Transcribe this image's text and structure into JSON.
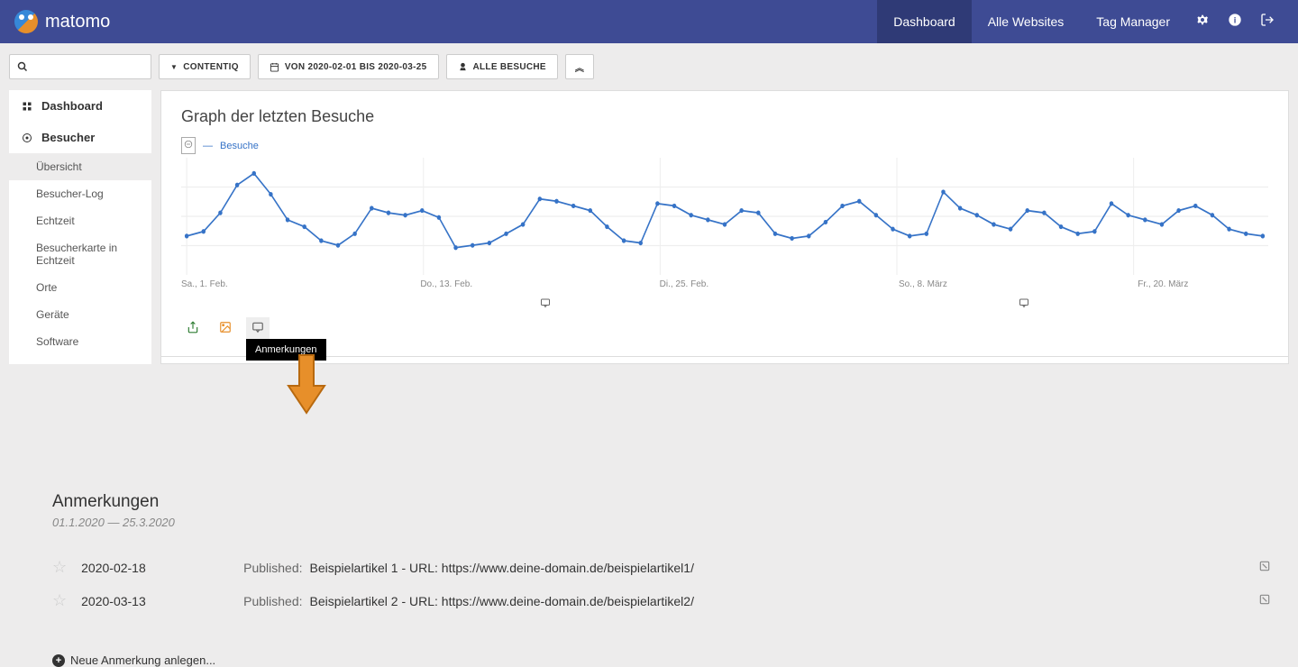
{
  "header": {
    "brand": "matomo",
    "nav": {
      "dashboard": "Dashboard",
      "all_websites": "Alle Websites",
      "tag_manager": "Tag Manager"
    }
  },
  "toolbar": {
    "site_selector": "CONTENTIQ",
    "date_range": "VON 2020-02-01 BIS 2020-03-25",
    "segment": "ALLE BESUCHE"
  },
  "sidebar": {
    "dashboard": "Dashboard",
    "visitors": "Besucher",
    "items": {
      "overview": "Übersicht",
      "visitor_log": "Besucher-Log",
      "realtime": "Echtzeit",
      "realtime_map": "Besucherkarte in Echtzeit",
      "locations": "Orte",
      "devices": "Geräte",
      "software": "Software"
    }
  },
  "chart": {
    "title": "Graph der letzten Besuche",
    "legend_label": "Besuche",
    "x_labels": {
      "l0": "Sa., 1. Feb.",
      "l1": "Do., 13. Feb.",
      "l2": "Di., 25. Feb.",
      "l3": "So., 8. März",
      "l4": "Fr., 20. März"
    },
    "tooltip": "Anmerkungen"
  },
  "chart_data": {
    "type": "line",
    "series": [
      {
        "name": "Besuche",
        "values": [
          28,
          32,
          48,
          72,
          82,
          64,
          42,
          36,
          24,
          20,
          30,
          52,
          48,
          46,
          50,
          44,
          18,
          20,
          22,
          30,
          38,
          60,
          58,
          54,
          50,
          36,
          24,
          22,
          56,
          54,
          46,
          42,
          38,
          50,
          48,
          30,
          26,
          28,
          40,
          54,
          58,
          46,
          34,
          28,
          30,
          66,
          52,
          46,
          38,
          34,
          50,
          48,
          36,
          30,
          32,
          56,
          46,
          42,
          38,
          50,
          54,
          46,
          34,
          30,
          28
        ]
      }
    ],
    "ylim": [
      0,
      90
    ],
    "x_start": "2020-02-01",
    "x_end": "2020-03-25",
    "xlabel": "",
    "ylabel": ""
  },
  "annotations": {
    "title": "Anmerkungen",
    "date_range": "01.1.2020 — 25.3.2020",
    "rows": [
      {
        "date": "2020-02-18",
        "label": "Published:",
        "text": "Beispielartikel 1 - URL: https://www.deine-domain.de/beispielartikel1/"
      },
      {
        "date": "2020-03-13",
        "label": "Published:",
        "text": "Beispielartikel 2 - URL: https://www.deine-domain.de/beispielartikel2/"
      }
    ],
    "new_label": "Neue Anmerkung anlegen..."
  }
}
